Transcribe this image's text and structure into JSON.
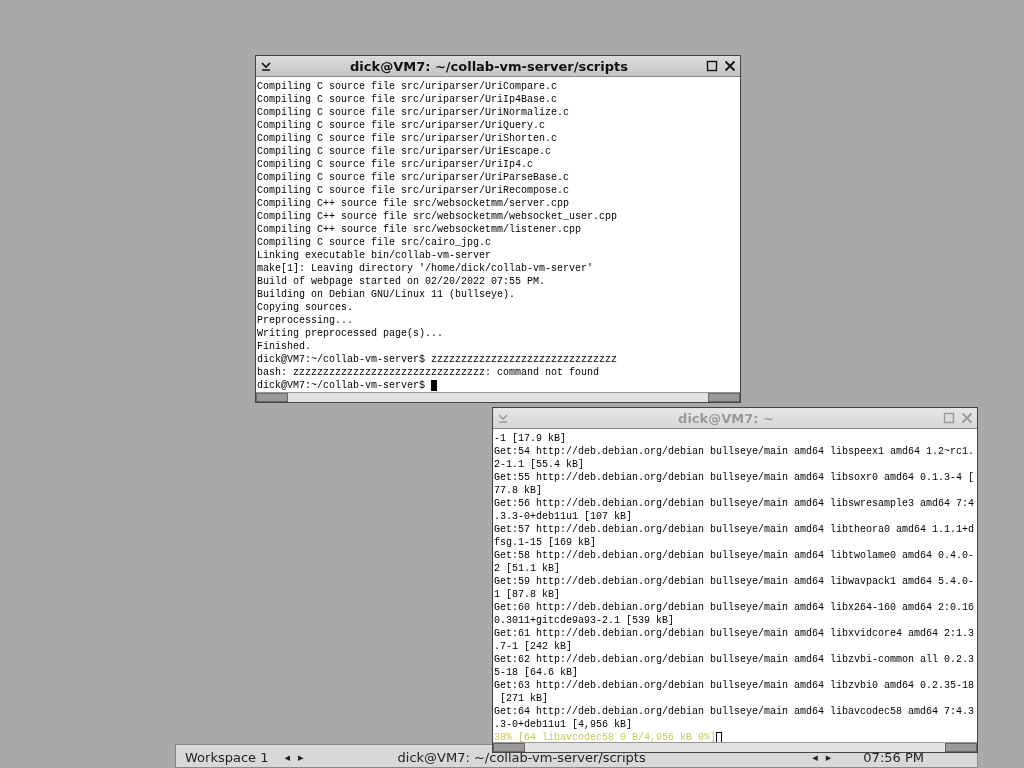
{
  "windows": [
    {
      "title": "dick@VM7: ~/collab-vm-server/scripts",
      "active": true,
      "lines": [
        {
          "kind": "output",
          "text": "Compiling C source file src/uriparser/UriCompare.c"
        },
        {
          "kind": "output",
          "text": "Compiling C source file src/uriparser/UriIp4Base.c"
        },
        {
          "kind": "output",
          "text": "Compiling C source file src/uriparser/UriNormalize.c"
        },
        {
          "kind": "output",
          "text": "Compiling C source file src/uriparser/UriQuery.c"
        },
        {
          "kind": "output",
          "text": "Compiling C source file src/uriparser/UriShorten.c"
        },
        {
          "kind": "output",
          "text": "Compiling C source file src/uriparser/UriEscape.c"
        },
        {
          "kind": "output",
          "text": "Compiling C source file src/uriparser/UriIp4.c"
        },
        {
          "kind": "output",
          "text": "Compiling C source file src/uriparser/UriParseBase.c"
        },
        {
          "kind": "output",
          "text": "Compiling C source file src/uriparser/UriRecompose.c"
        },
        {
          "kind": "output",
          "text": "Compiling C++ source file src/websocketmm/server.cpp"
        },
        {
          "kind": "output",
          "text": "Compiling C++ source file src/websocketmm/websocket_user.cpp"
        },
        {
          "kind": "output",
          "text": "Compiling C++ source file src/websocketmm/listener.cpp"
        },
        {
          "kind": "output",
          "text": "Compiling C source file src/cairo_jpg.c"
        },
        {
          "kind": "output",
          "text": "Linking executable bin/collab-vm-server"
        },
        {
          "kind": "output",
          "text": "make[1]: Leaving directory '/home/dick/collab-vm-server'"
        },
        {
          "kind": "output",
          "text": "Build of webpage started on 02/20/2022 07:55 PM."
        },
        {
          "kind": "output",
          "text": "Building on Debian GNU/Linux 11 (bullseye)."
        },
        {
          "kind": "output",
          "text": "Copying sources."
        },
        {
          "kind": "output",
          "text": "Preprocessing..."
        },
        {
          "kind": "output",
          "text": "Writing preprocessed page(s)..."
        },
        {
          "kind": "output",
          "text": "Finished."
        },
        {
          "kind": "output",
          "text": "dick@VM7:~/collab-vm-server$ zzzzzzzzzzzzzzzzzzzzzzzzzzzzzzz"
        },
        {
          "kind": "output",
          "text": "bash: zzzzzzzzzzzzzzzzzzzzzzzzzzzzzzzz: command not found"
        },
        {
          "kind": "prompt",
          "text": "dick@VM7:~/collab-vm-server$ "
        }
      ]
    },
    {
      "title": "dick@VM7: ~",
      "active": false,
      "lines": [
        {
          "kind": "output",
          "text": "-1 [17.9 kB]"
        },
        {
          "kind": "output",
          "text": "Get:54 http://deb.debian.org/debian bullseye/main amd64 libspeex1 amd64 1.2~rc1."
        },
        {
          "kind": "output",
          "text": "2-1.1 [55.4 kB]"
        },
        {
          "kind": "output",
          "text": "Get:55 http://deb.debian.org/debian bullseye/main amd64 libsoxr0 amd64 0.1.3-4 ["
        },
        {
          "kind": "output",
          "text": "77.8 kB]"
        },
        {
          "kind": "output",
          "text": "Get:56 http://deb.debian.org/debian bullseye/main amd64 libswresample3 amd64 7:4"
        },
        {
          "kind": "output",
          "text": ".3.3-0+deb11u1 [107 kB]"
        },
        {
          "kind": "output",
          "text": "Get:57 http://deb.debian.org/debian bullseye/main amd64 libtheora0 amd64 1.1.1+d"
        },
        {
          "kind": "output",
          "text": "fsg.1-15 [169 kB]"
        },
        {
          "kind": "output",
          "text": "Get:58 http://deb.debian.org/debian bullseye/main amd64 libtwolame0 amd64 0.4.0-"
        },
        {
          "kind": "output",
          "text": "2 [51.1 kB]"
        },
        {
          "kind": "output",
          "text": "Get:59 http://deb.debian.org/debian bullseye/main amd64 libwavpack1 amd64 5.4.0-"
        },
        {
          "kind": "output",
          "text": "1 [87.8 kB]"
        },
        {
          "kind": "output",
          "text": "Get:60 http://deb.debian.org/debian bullseye/main amd64 libx264-160 amd64 2:0.16"
        },
        {
          "kind": "output",
          "text": "0.3011+gitcde9a93-2.1 [539 kB]"
        },
        {
          "kind": "output",
          "text": "Get:61 http://deb.debian.org/debian bullseye/main amd64 libxvidcore4 amd64 2:1.3"
        },
        {
          "kind": "output",
          "text": ".7-1 [242 kB]"
        },
        {
          "kind": "output",
          "text": "Get:62 http://deb.debian.org/debian bullseye/main amd64 libzvbi-common all 0.2.3"
        },
        {
          "kind": "output",
          "text": "5-18 [64.6 kB]"
        },
        {
          "kind": "output",
          "text": "Get:63 http://deb.debian.org/debian bullseye/main amd64 libzvbi0 amd64 0.2.35-18"
        },
        {
          "kind": "output",
          "text": " [271 kB]"
        },
        {
          "kind": "output",
          "text": "Get:64 http://deb.debian.org/debian bullseye/main amd64 libavcodec58 amd64 7:4.3"
        },
        {
          "kind": "output",
          "text": ".3-0+deb11u1 [4,956 kB]"
        },
        {
          "kind": "progress",
          "text": "38% [64 libavcodec58 0 B/4,956 kB 0%]"
        }
      ]
    }
  ],
  "taskbar": {
    "workspace": "Workspace 1",
    "workspace_prev": "◂",
    "workspace_next": "▸",
    "task": "dick@VM7: ~/collab-vm-server/scripts",
    "task_prev": "◂",
    "task_next": "▸",
    "clock": "07:56 PM"
  }
}
